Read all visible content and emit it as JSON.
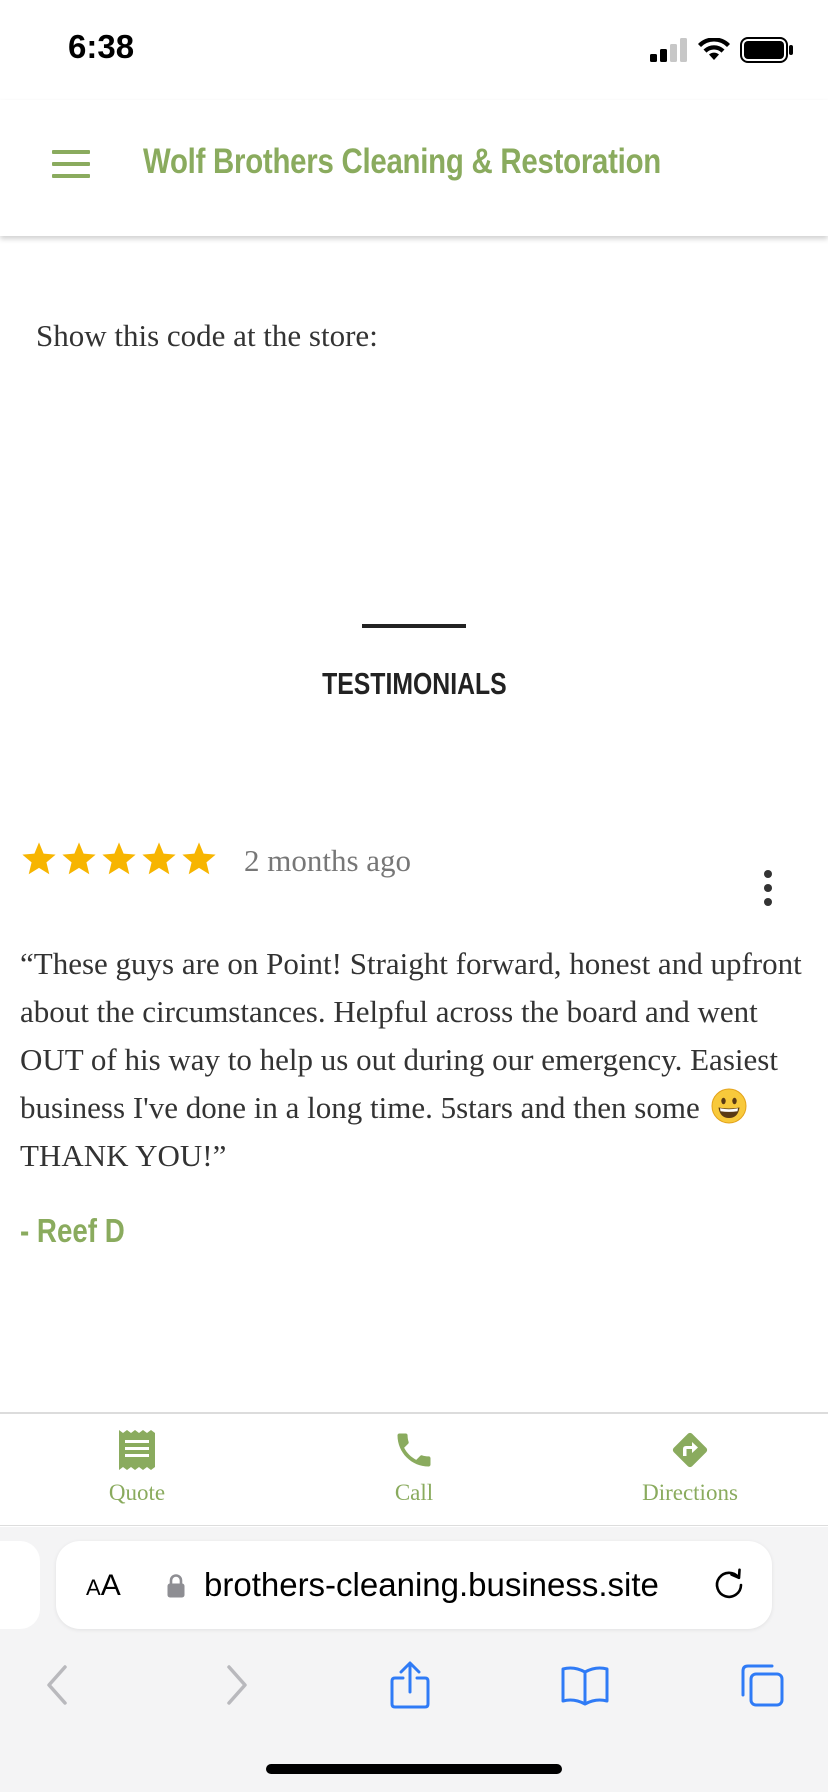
{
  "status_bar": {
    "time": "6:38"
  },
  "header": {
    "title": "Wolf Brothers Cleaning & Restoration"
  },
  "offer": {
    "text": "Show this code at the store:"
  },
  "testimonials": {
    "heading": "TESTIMONIALS",
    "review": {
      "rating": 5,
      "max_rating": 5,
      "date": "2 months ago",
      "text_part1": "“These guys are on Point! Straight forward, honest and upfront about the circumstances. Helpful across the board and went OUT of his way to help us out during our emergency. Easiest business I've done in a long time. 5stars and then some",
      "text_part2": "THANK YOU!”",
      "emoji": "grinning-face-emoji",
      "author": "- Reef D"
    }
  },
  "action_bar": {
    "quote_label": "Quote",
    "call_label": "Call",
    "directions_label": "Directions"
  },
  "browser": {
    "aa_small": "A",
    "aa_big": "A",
    "url": "brothers-cleaning.business.site"
  },
  "colors": {
    "brand_green": "#8aab5e",
    "star_yellow": "#f7b500",
    "ios_blue": "#2f7bf6"
  }
}
